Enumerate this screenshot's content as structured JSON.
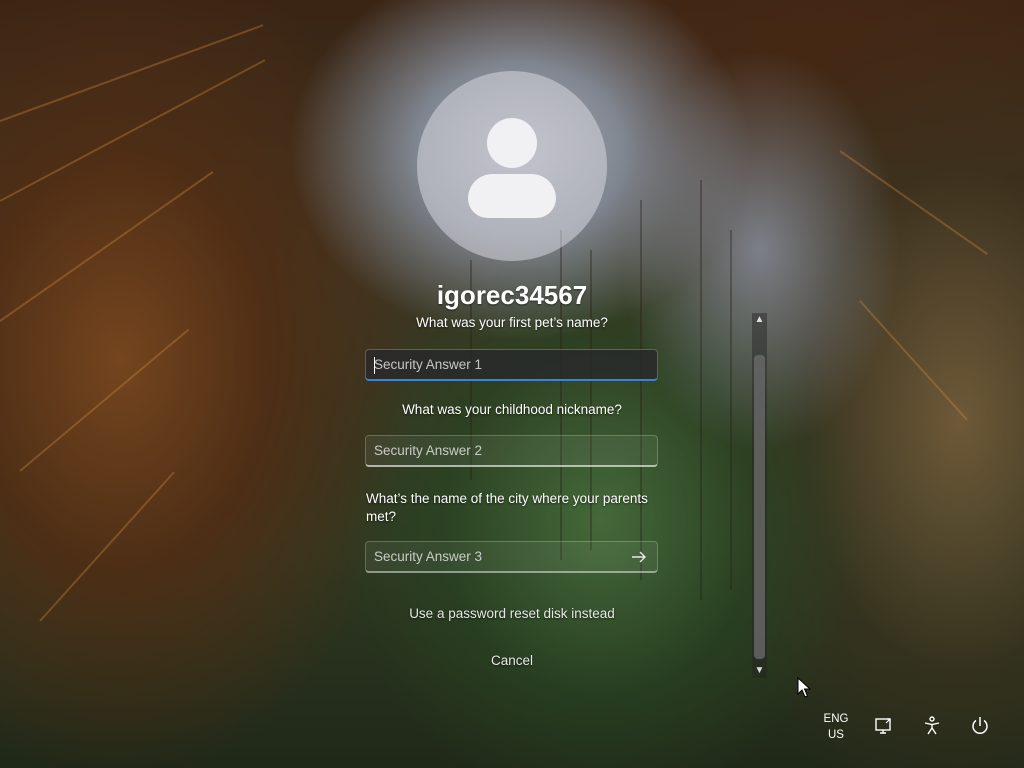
{
  "user": {
    "name": "igorec34567"
  },
  "security": {
    "question1": "What was your first pet’s name?",
    "answer1_placeholder": "Security Answer 1",
    "question2": "What was your childhood nickname?",
    "answer2_placeholder": "Security Answer 2",
    "question3": "What’s the name of the city where your parents met?",
    "answer3_placeholder": "Security Answer 3"
  },
  "links": {
    "reset_disk": "Use a password reset disk instead",
    "cancel": "Cancel"
  },
  "tray": {
    "language": "ENG",
    "region": "US",
    "icons": [
      "network-icon",
      "accessibility-icon",
      "power-icon"
    ]
  },
  "colors": {
    "focus_accent": "#3a84d6",
    "avatar_fill": "#f1f1f3"
  }
}
